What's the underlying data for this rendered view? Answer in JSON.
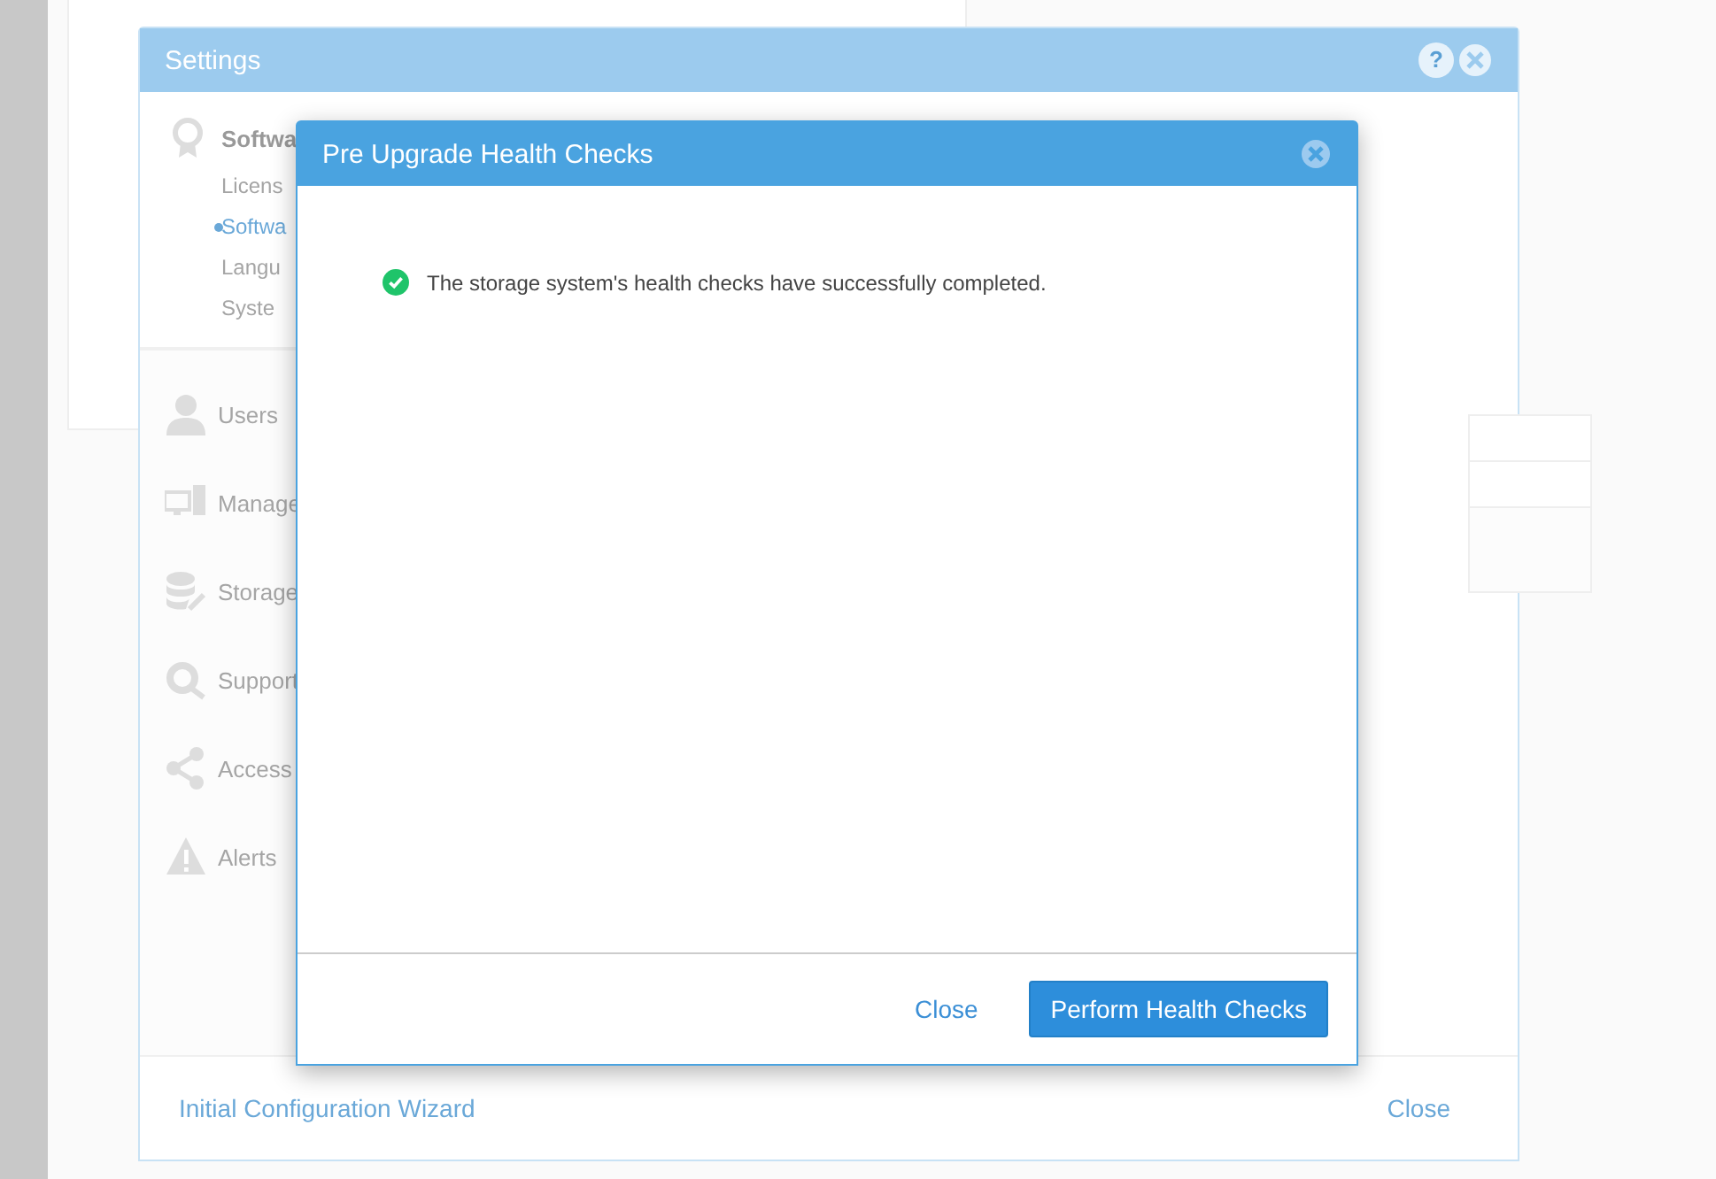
{
  "settings_window": {
    "title": "Settings",
    "help_button": "?",
    "nav_group": {
      "label": "Softwa",
      "children": [
        {
          "label": "Licens",
          "selected": false
        },
        {
          "label": "Softwa",
          "selected": true
        },
        {
          "label": "Langu",
          "selected": false
        },
        {
          "label": "Syste",
          "selected": false
        }
      ]
    },
    "nav_items": [
      {
        "label": "Users",
        "kind": "user"
      },
      {
        "label": "Manage",
        "kind": "monitor"
      },
      {
        "label": "Storage",
        "kind": "storage"
      },
      {
        "label": "Support",
        "kind": "support"
      },
      {
        "label": "Access",
        "kind": "share"
      },
      {
        "label": "Alerts",
        "kind": "alert"
      }
    ],
    "footer": {
      "wizard_link": "Initial Configuration Wizard",
      "close_button": "Close"
    }
  },
  "dialog": {
    "title": "Pre Upgrade Health Checks",
    "message": "The storage system's health checks have successfully completed.",
    "close_link": "Close",
    "primary_button": "Perform Health Checks"
  }
}
